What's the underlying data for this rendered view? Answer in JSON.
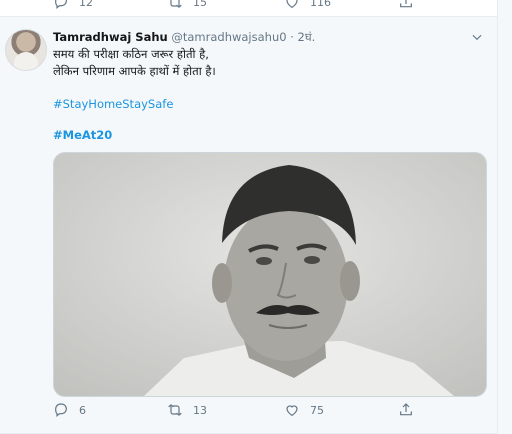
{
  "previous_tweet": {
    "actions": {
      "reply_count": "12",
      "retweet_count": "15",
      "like_count": "116"
    }
  },
  "tweet": {
    "author_name": "Tamradhwaj Sahu",
    "handle": "@tamradhwajsahu0",
    "separator": "·",
    "time": "2घं.",
    "text_lines": [
      "समय की परीक्षा कठिन जरूर होती है,",
      "लेकिन परिणाम आपके हाथों में होता है।"
    ],
    "hashtags": [
      "#StayHomeStaySafe",
      "#MeAt20"
    ],
    "media": {
      "icon": "photo"
    },
    "actions": {
      "reply_count": "6",
      "retweet_count": "13",
      "like_count": "75"
    }
  },
  "colors": {
    "link": "#1b95e0",
    "muted": "#657786",
    "background": "#f5f8fa"
  },
  "icons": [
    "reply-icon",
    "retweet-icon",
    "like-icon",
    "share-icon",
    "chevron-down-icon"
  ]
}
